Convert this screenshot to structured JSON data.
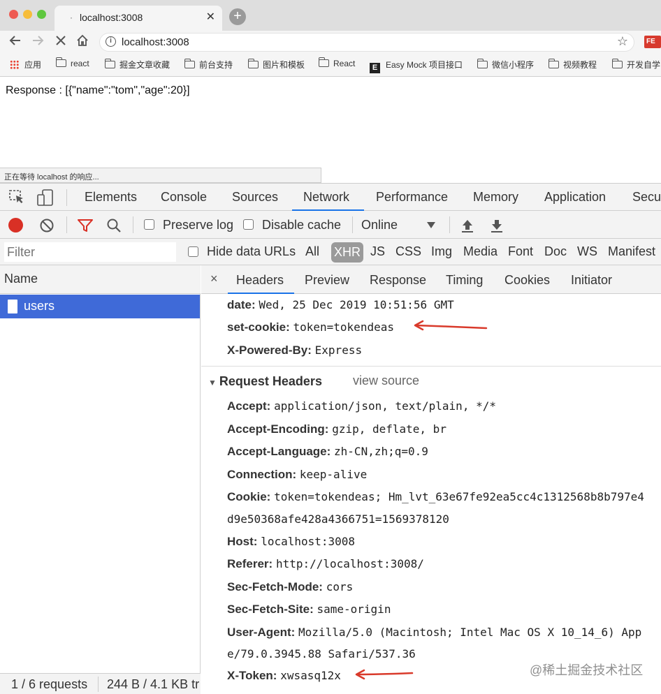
{
  "window": {
    "traffic_lights": [
      "#ee5b53",
      "#f6bd3b",
      "#5fc73f"
    ]
  },
  "tab": {
    "title": "localhost:3008",
    "close": "✕",
    "new_tab": "+"
  },
  "omnibox": {
    "url": "localhost:3008"
  },
  "extension": {
    "label": "FE"
  },
  "bookmarks": [
    {
      "label": "应用",
      "icon": "apps-grid-icon"
    },
    {
      "label": "react",
      "icon": "folder-icon"
    },
    {
      "label": "掘金文章收藏",
      "icon": "folder-icon"
    },
    {
      "label": "前台支持",
      "icon": "folder-icon"
    },
    {
      "label": "图片和模板",
      "icon": "folder-icon"
    },
    {
      "label": "React",
      "icon": "folder-icon"
    },
    {
      "label": "Easy Mock 项目接口",
      "icon": "easymock-icon"
    },
    {
      "label": "微信小程序",
      "icon": "folder-icon"
    },
    {
      "label": "视频教程",
      "icon": "folder-icon"
    },
    {
      "label": "开发自学",
      "icon": "folder-icon"
    }
  ],
  "page": {
    "response_text": "Response : [{\"name\":\"tom\",\"age\":20}]",
    "status_bubble": "正在等待 localhost 的响应..."
  },
  "devtools": {
    "tabs": [
      "Elements",
      "Console",
      "Sources",
      "Network",
      "Performance",
      "Memory",
      "Application",
      "Secu"
    ],
    "active_tab": "Network",
    "accent_color": "#1a73e8",
    "controls": {
      "preserve_log": "Preserve log",
      "disable_cache": "Disable cache",
      "throttle": "Online"
    },
    "filter": {
      "placeholder": "Filter",
      "hide_data_urls": "Hide data URLs",
      "types": [
        "All",
        "XHR",
        "JS",
        "CSS",
        "Img",
        "Media",
        "Font",
        "Doc",
        "WS",
        "Manifest"
      ],
      "active_type": "XHR"
    },
    "list": {
      "header": "Name",
      "rows": [
        {
          "name": "users"
        }
      ],
      "selected_color": "#3f6ad8",
      "summary_requests": "1 / 6 requests",
      "summary_size": "244 B / 4.1 KB tr"
    },
    "details": {
      "close": "×",
      "tabs": [
        "Headers",
        "Preview",
        "Response",
        "Timing",
        "Cookies",
        "Initiator"
      ],
      "active_tab": "Headers",
      "response_headers": [
        {
          "name": "date:",
          "value": "Wed, 25 Dec 2019 10:51:56 GMT"
        },
        {
          "name": "set-cookie:",
          "value": "token=tokendeas"
        },
        {
          "name": "X-Powered-By:",
          "value": "Express"
        }
      ],
      "request_section_title": "Request Headers",
      "view_source": "view source",
      "request_headers": [
        {
          "name": "Accept:",
          "value": "application/json, text/plain, */*"
        },
        {
          "name": "Accept-Encoding:",
          "value": "gzip, deflate, br"
        },
        {
          "name": "Accept-Language:",
          "value": "zh-CN,zh;q=0.9"
        },
        {
          "name": "Connection:",
          "value": "keep-alive"
        },
        {
          "name": "Cookie:",
          "value": "token=tokendeas; Hm_lvt_63e67fe92ea5cc4c1312568b8b797e4",
          "cont": "d9e50368afe428a4366751=1569378120"
        },
        {
          "name": "Host:",
          "value": "localhost:3008"
        },
        {
          "name": "Referer:",
          "value": "http://localhost:3008/"
        },
        {
          "name": "Sec-Fetch-Mode:",
          "value": "cors"
        },
        {
          "name": "Sec-Fetch-Site:",
          "value": "same-origin"
        },
        {
          "name": "User-Agent:",
          "value": "Mozilla/5.0 (Macintosh; Intel Mac OS X 10_14_6) App",
          "cont": "e/79.0.3945.88 Safari/537.36"
        },
        {
          "name": "X-Token:",
          "value": "xwsasq12x"
        }
      ],
      "annotation_color": "#d93a2b"
    }
  },
  "watermark": "@稀土掘金技术社区"
}
